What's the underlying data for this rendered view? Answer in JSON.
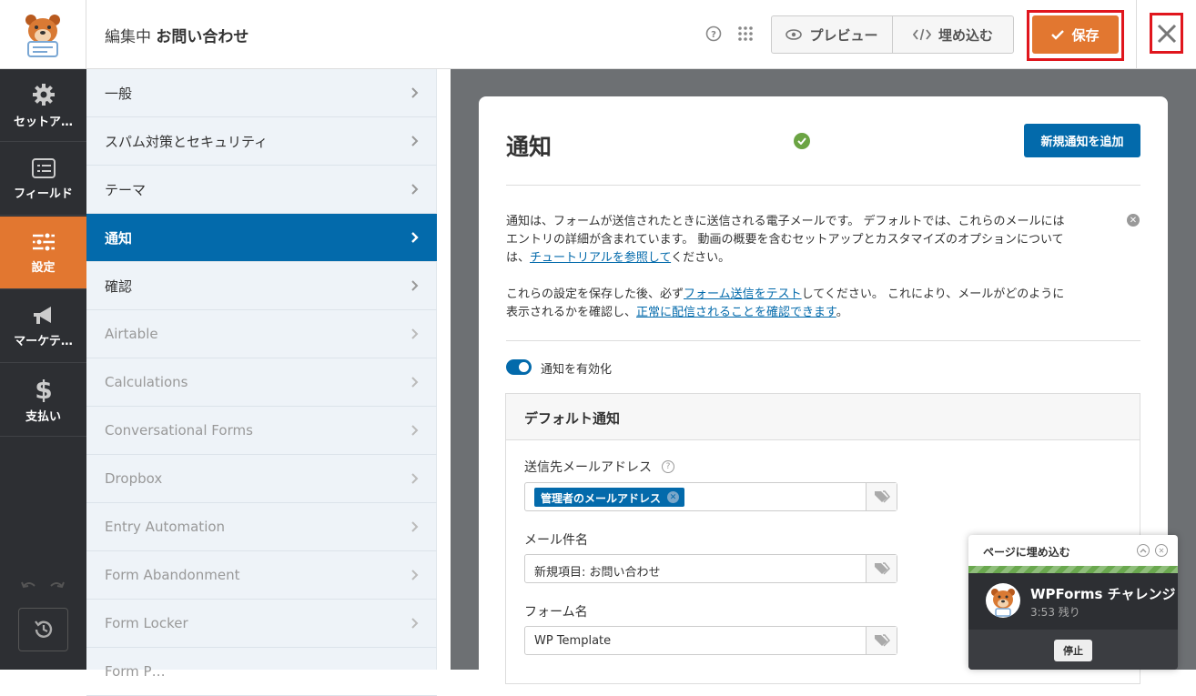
{
  "header": {
    "title_prefix": "編集中",
    "form_name": "お問い合わせ",
    "preview_label": "プレビュー",
    "embed_label": "埋め込む",
    "save_label": "保存"
  },
  "sidebar": {
    "items": [
      {
        "label": "セットア…",
        "icon": "gear-icon"
      },
      {
        "label": "フィールド",
        "icon": "list-icon"
      },
      {
        "label": "設定",
        "icon": "sliders-icon",
        "active": true
      },
      {
        "label": "マーケテ…",
        "icon": "megaphone-icon"
      },
      {
        "label": "支払い",
        "icon": "dollar-icon"
      }
    ]
  },
  "settings_menu": {
    "items": [
      {
        "label": "一般"
      },
      {
        "label": "スパム対策とセキュリティ"
      },
      {
        "label": "テーマ"
      },
      {
        "label": "通知",
        "active": true
      },
      {
        "label": "確認"
      },
      {
        "label": "Airtable",
        "disabled": true
      },
      {
        "label": "Calculations",
        "disabled": true
      },
      {
        "label": "Conversational Forms",
        "disabled": true
      },
      {
        "label": "Dropbox",
        "disabled": true
      },
      {
        "label": "Entry Automation",
        "disabled": true
      },
      {
        "label": "Form Abandonment",
        "disabled": true
      },
      {
        "label": "Form Locker",
        "disabled": true
      },
      {
        "label": "Form P…",
        "disabled": true
      }
    ]
  },
  "panel": {
    "title": "通知",
    "add_button": "新規通知を追加",
    "info1_a": "通知は、フォームが送信されたときに送信される電子メールです。 デフォルトでは、これらのメールには",
    "info1_b": "エントリの詳細が含まれています。 動画の概要を含むセットアップとカスタマイズのオプションについて",
    "info1_c_pre": "は、",
    "info1_link": "チュートリアルを参照して",
    "info1_c_post": "ください。",
    "info2_pre": "これらの設定を保存した後、必ず",
    "info2_link1": "フォーム送信をテスト",
    "info2_mid": "してください。 これにより、メールがどのように",
    "info2_b_pre": "表示されるかを確認し、",
    "info2_link2": "正常に配信されることを確認できます",
    "info2_end": "。",
    "toggle_label": "通知を有効化",
    "section_title": "デフォルト通知",
    "send_to_label": "送信先メールアドレス",
    "send_to_chip": "管理者のメールアドレス",
    "subject_label": "メール件名",
    "subject_value": "新規項目: お問い合わせ",
    "form_name_label": "フォーム名",
    "form_name_value": "WP Template"
  },
  "challenge": {
    "header": "ページに埋め込む",
    "title": "WPForms チャレンジ",
    "time_left": "3:53 残り",
    "stop_label": "停止"
  },
  "colors": {
    "accent": "#e27730",
    "primary": "#036aab",
    "sidebar_bg": "#2d2f33",
    "highlight_red": "#e0161d"
  }
}
